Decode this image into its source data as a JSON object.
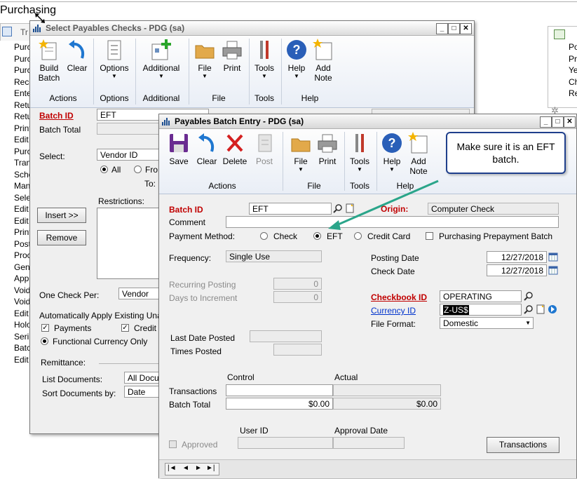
{
  "app_title": "Purchasing",
  "left_nav": {
    "tab_label": "Tr",
    "items": [
      "Purc",
      "Purc",
      "Purc",
      "Reco",
      "Ente",
      "Retu",
      "Retu",
      "Print",
      "Edit",
      "Purc",
      "Tran",
      "Sche",
      "Man",
      "Sele",
      "Edit",
      "Edit",
      "Print",
      "Post",
      "Proc",
      "Gen",
      "Appl",
      "Void",
      "Void",
      "Edit",
      "Holo",
      "Seri",
      "Batc",
      "Edit"
    ]
  },
  "right_nav": {
    "items": [
      "Po",
      "Pr",
      "Ye",
      "Ch",
      "Re"
    ]
  },
  "select_checks": {
    "title": "Select Payables Checks  -  PDG (sa)",
    "ribbon": {
      "buttons": {
        "build_batch": "Build\nBatch",
        "clear": "Clear",
        "options": "Options",
        "additional": "Additional",
        "file": "File",
        "print": "Print",
        "tools": "Tools",
        "help": "Help",
        "add_note": "Add\nNote"
      },
      "groups": {
        "actions": "Actions",
        "options": "Options",
        "additional": "Additional",
        "file": "File",
        "tools": "Tools",
        "help": "Help"
      }
    },
    "batch_id_label": "Batch ID",
    "batch_id_value": "EFT",
    "batch_total_label": "Batch Total",
    "select_label": "Select:",
    "select_value": "Vendor ID",
    "radio_all": "All",
    "radio_from": "Fro",
    "to_label": "To:",
    "restrictions_label": "Restrictions:",
    "insert_button": "Insert >>",
    "remove_button": "Remove",
    "one_check_per_label": "One Check Per:",
    "one_check_per_value": "Vendor",
    "auto_apply_label": "Automatically Apply Existing Unapp",
    "payments_label": "Payments",
    "credit_label": "Credit N",
    "functional_currency_label": "Functional Currency Only",
    "remittance_label": "Remittance:",
    "list_documents_label": "List Documents:",
    "list_documents_value": "All Docur",
    "sort_documents_label": "Sort Documents by:",
    "sort_documents_value": "Date"
  },
  "batch_entry": {
    "title": "Payables Batch Entry  -  PDG (sa)",
    "ribbon": {
      "buttons": {
        "save": "Save",
        "clear": "Clear",
        "delete": "Delete",
        "post": "Post",
        "file": "File",
        "print": "Print",
        "tools": "Tools",
        "help": "Help",
        "add_note": "Add\nNote"
      },
      "groups": {
        "actions": "Actions",
        "file": "File",
        "tools": "Tools",
        "help": "Help"
      }
    },
    "callout_text": "Make sure it is an EFT batch.",
    "batch_id_label": "Batch ID",
    "batch_id_value": "EFT",
    "origin_label": "Origin:",
    "origin_value": "Computer Check",
    "comment_label": "Comment",
    "comment_value": "",
    "payment_method_label": "Payment Method:",
    "payment_method_options": [
      "Check",
      "EFT",
      "Credit Card"
    ],
    "payment_method_selected": "EFT",
    "prepayment_label": "Purchasing Prepayment Batch",
    "frequency_label": "Frequency:",
    "frequency_value": "Single Use",
    "recurring_posting_label": "Recurring Posting",
    "recurring_posting_value": "0",
    "days_increment_label": "Days to Increment",
    "days_increment_value": "0",
    "posting_date_label": "Posting Date",
    "posting_date_value": "12/27/2018",
    "check_date_label": "Check Date",
    "check_date_value": "12/27/2018",
    "checkbook_id_label": "Checkbook ID",
    "checkbook_id_value": "OPERATING",
    "currency_id_label": "Currency ID",
    "currency_id_value": "Z-US$",
    "file_format_label": "File Format:",
    "file_format_value": "Domestic",
    "last_date_posted_label": "Last Date Posted",
    "times_posted_label": "Times Posted",
    "control_label": "Control",
    "actual_label": "Actual",
    "transactions_label": "Transactions",
    "batch_total_label": "Batch Total",
    "batch_total_control": "$0.00",
    "batch_total_actual": "$0.00",
    "user_id_label": "User ID",
    "approval_date_label": "Approval Date",
    "approved_label": "Approved",
    "transactions_button": "Transactions",
    "nav_first": "|◄",
    "nav_prev": "◄",
    "nav_next": "►",
    "nav_last": "►|"
  },
  "colors": {
    "required_red": "#c00000",
    "link_blue": "#0033cc",
    "callout_border": "#1f3f8c",
    "arrow_green": "#2aa58a"
  }
}
